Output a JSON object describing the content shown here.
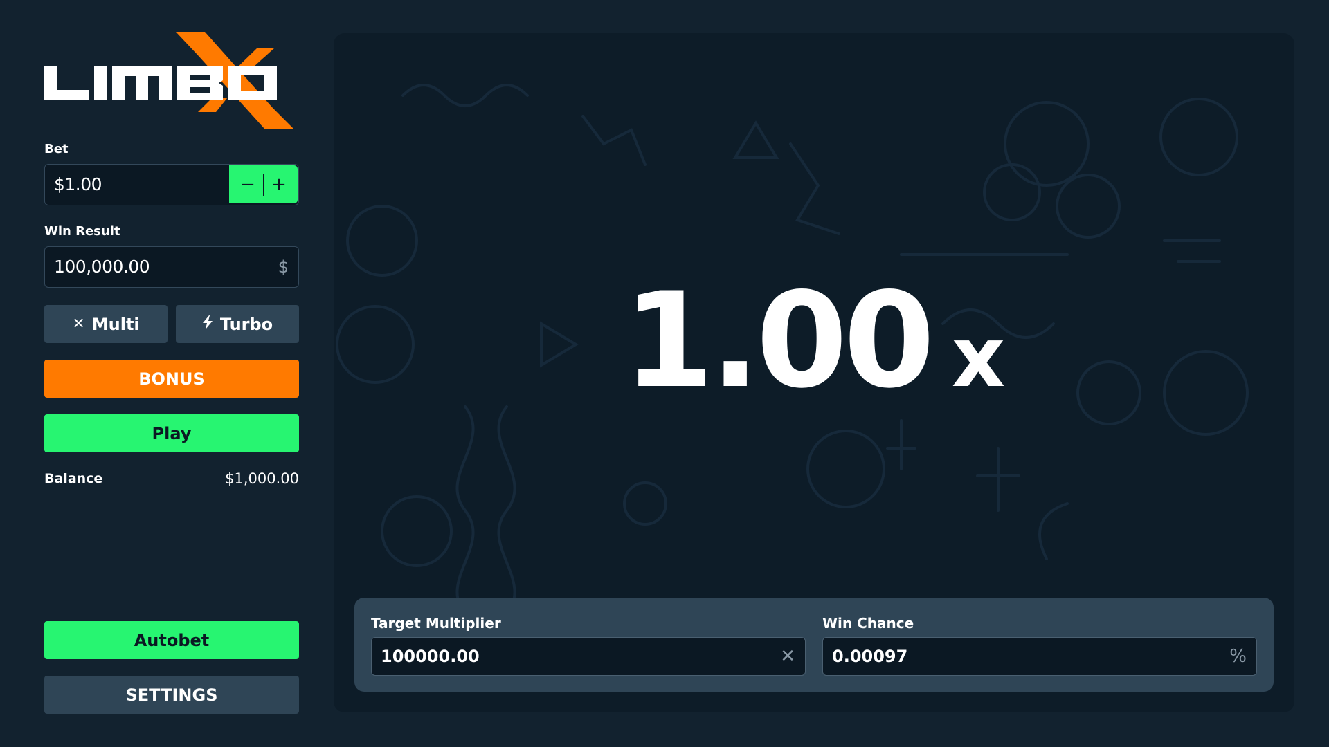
{
  "logo": {
    "text": "LIMBO",
    "accent_color": "#ff7a00"
  },
  "bet": {
    "label": "Bet",
    "value": "$1.00",
    "decrement": "−",
    "increment": "+"
  },
  "win_result": {
    "label": "Win Result",
    "value": "100,000.00",
    "suffix": "$"
  },
  "toggles": {
    "multi": {
      "icon": "close-icon",
      "label": "Multi"
    },
    "turbo": {
      "icon": "bolt-icon",
      "label": "Turbo"
    }
  },
  "buttons": {
    "bonus": "BONUS",
    "play": "Play",
    "autobet": "Autobet",
    "settings": "SETTINGS"
  },
  "balance": {
    "label": "Balance",
    "value": "$1,000.00"
  },
  "game": {
    "multiplier": "1.00",
    "multiplier_suffix": "x"
  },
  "target_multiplier": {
    "label": "Target Multiplier",
    "value": "100000.00",
    "suffix": "✕"
  },
  "win_chance": {
    "label": "Win Chance",
    "value": "0.00097",
    "suffix": "%"
  },
  "colors": {
    "background": "#12222f",
    "panel": "#0d1c28",
    "accent_green": "#27f571",
    "accent_orange": "#ff7a00",
    "control_gray": "#2f4556"
  }
}
